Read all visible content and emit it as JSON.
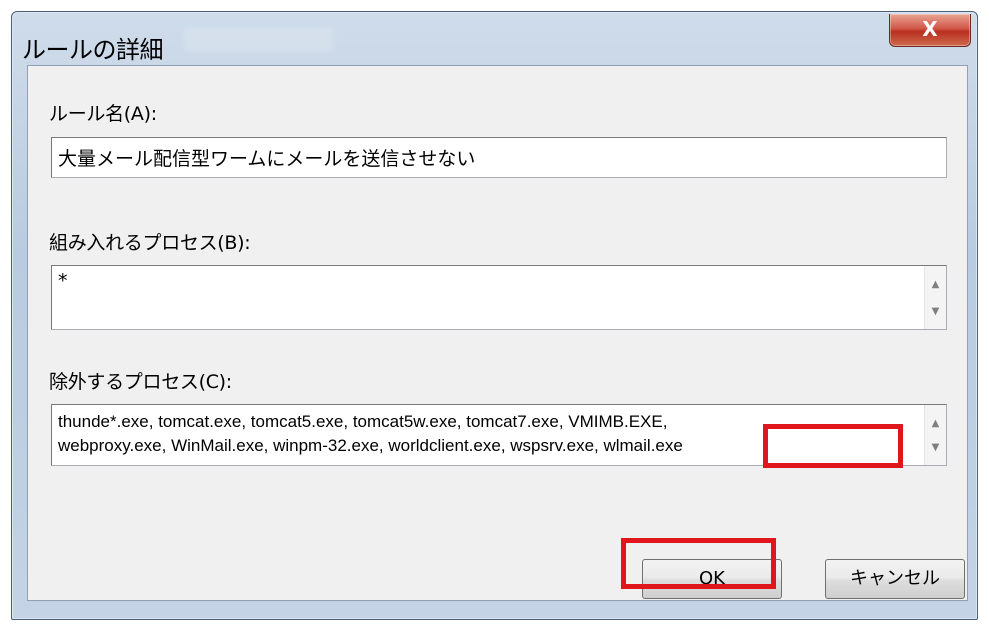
{
  "window": {
    "title": "ルールの詳細",
    "close_glyph": "X"
  },
  "rule_name": {
    "label": "ルール名(A):",
    "value": "大量メール配信型ワームにメールを送信させない"
  },
  "include_process": {
    "label": "組み入れるプロセス(B):",
    "value": "*"
  },
  "exclude_process": {
    "label": "除外するプロセス(C):",
    "line1": "thunde*.exe, tomcat.exe, tomcat5.exe, tomcat5w.exe, tomcat7.exe, VMIMB.EXE,",
    "line2": "webproxy.exe, WinMail.exe, winpm-32.exe, worldclient.exe, wspsrv.exe, wlmail.exe"
  },
  "buttons": {
    "ok": "OK",
    "cancel": "キャンセル"
  },
  "highlight_color": "#e0161c"
}
